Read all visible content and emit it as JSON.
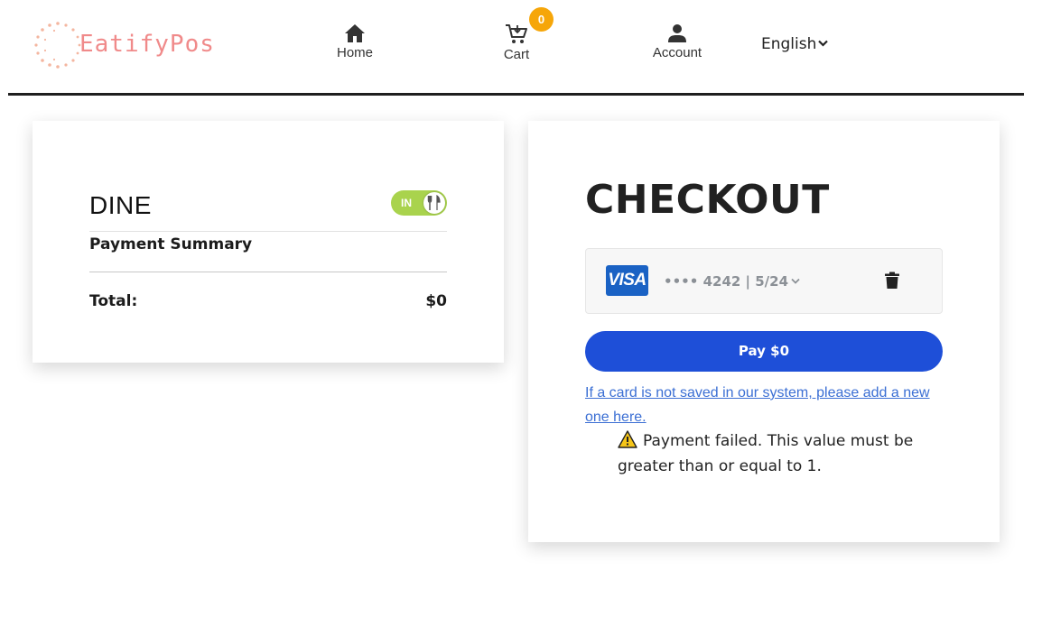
{
  "header": {
    "logo_text": "EatifyPos",
    "nav": {
      "home_label": "Home",
      "cart_label": "Cart",
      "cart_count": "0",
      "account_label": "Account"
    },
    "language": "English"
  },
  "summary": {
    "mode_label": "DINE",
    "toggle_text": "IN",
    "title": "Payment Summary",
    "total_label": "Total:",
    "total_value": "$0"
  },
  "checkout": {
    "title": "CHECKOUT",
    "card": {
      "brand": "VISA",
      "info": "•••• 4242 | 5/24"
    },
    "pay_label": "Pay $0",
    "add_card_link": "If a card is not saved in our system, please add a new one here.",
    "error_message": "Payment failed. This value must be greater than or equal to 1."
  },
  "colors": {
    "accent_blue": "#1e4fd8",
    "badge_orange": "#f6a609",
    "toggle_green": "#a9d34d",
    "logo_pink": "#f08a8a",
    "visa_blue": "#1a62c4"
  },
  "icons": [
    "home-icon",
    "cart-icon",
    "account-icon",
    "chevron-down-icon",
    "utensils-icon",
    "visa-icon",
    "trash-icon",
    "warning-icon"
  ]
}
